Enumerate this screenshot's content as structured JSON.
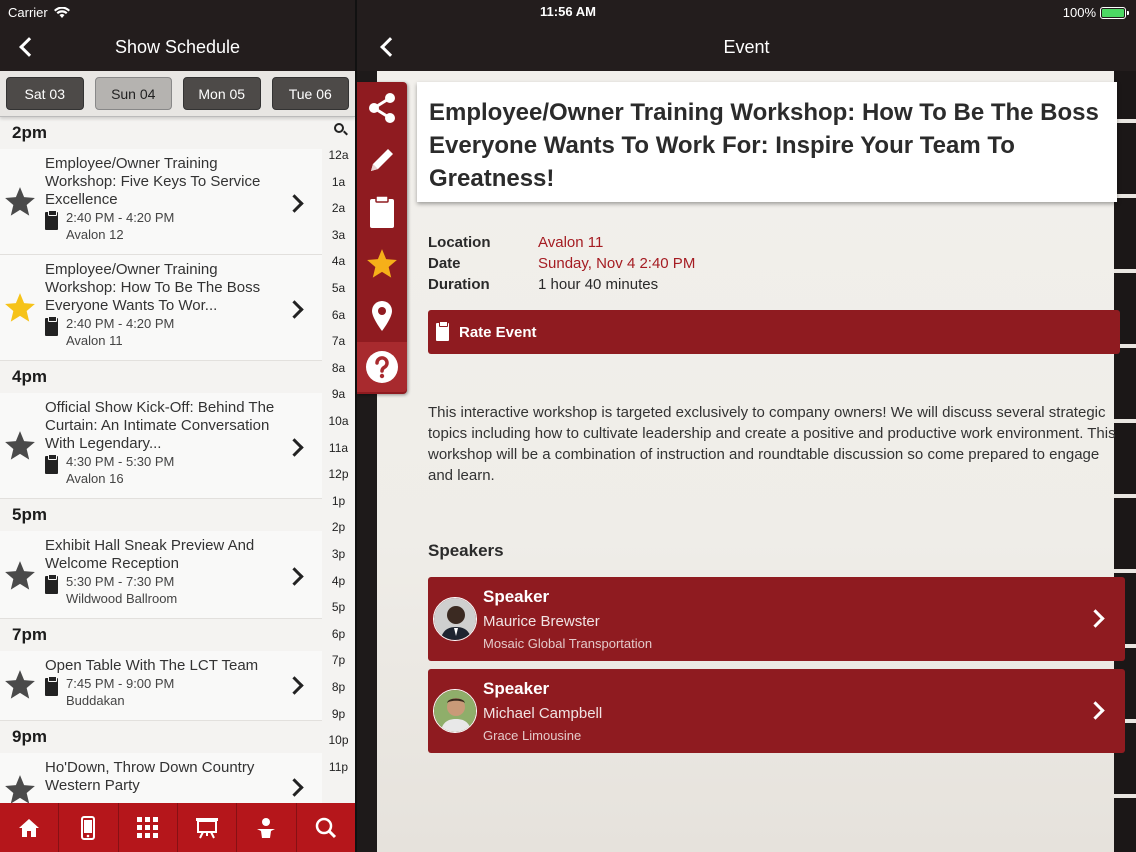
{
  "status": {
    "carrier": "Carrier",
    "time": "11:56 AM",
    "battery": "100%"
  },
  "left": {
    "title": "Show Schedule",
    "days": [
      "Sat 03",
      "Sun 04",
      "Mon 05",
      "Tue 06"
    ],
    "active_day": "Sun 04",
    "groups": [
      {
        "hour": "2pm",
        "events": [
          {
            "title": "Employee/Owner Training Workshop: Five Keys To Service Excellence",
            "time": "2:40 PM - 4:20 PM",
            "location": "Avalon 12",
            "favorite": false
          },
          {
            "title": "Employee/Owner Training Workshop: How To Be The Boss Everyone Wants To Wor...",
            "time": "2:40 PM - 4:20 PM",
            "location": "Avalon 11",
            "favorite": true
          }
        ]
      },
      {
        "hour": "4pm",
        "events": [
          {
            "title": "Official Show Kick-Off: Behind The Curtain: An Intimate Conversation With Legendary...",
            "time": "4:30 PM - 5:30 PM",
            "location": "Avalon 16",
            "favorite": false
          }
        ]
      },
      {
        "hour": "5pm",
        "events": [
          {
            "title": "Exhibit Hall Sneak Preview And Welcome Reception",
            "time": "5:30 PM - 7:30 PM",
            "location": "Wildwood Ballroom",
            "favorite": false
          }
        ]
      },
      {
        "hour": "7pm",
        "events": [
          {
            "title": "Open Table With The LCT Team",
            "time": "7:45 PM - 9:00 PM",
            "location": "Buddakan",
            "favorite": false
          }
        ]
      },
      {
        "hour": "9pm",
        "events": [
          {
            "title": "Ho'Down, Throw Down Country Western Party",
            "time": "",
            "location": "",
            "favorite": false
          }
        ]
      }
    ],
    "index": [
      "12a",
      "1a",
      "2a",
      "3a",
      "4a",
      "5a",
      "6a",
      "7a",
      "8a",
      "9a",
      "10a",
      "11a",
      "12p",
      "1p",
      "2p",
      "3p",
      "4p",
      "5p",
      "6p",
      "7p",
      "8p",
      "9p",
      "10p",
      "11p"
    ],
    "tabs": [
      "home-icon",
      "phone-icon",
      "grid-icon",
      "presentation-icon",
      "person-icon",
      "search-icon"
    ]
  },
  "event": {
    "nav_title": "Event",
    "title": "Employee/Owner Training Workshop: How To Be The Boss Everyone Wants To Work For: Inspire Your Team To Greatness!",
    "location_label": "Location",
    "location": "Avalon 11",
    "date_label": "Date",
    "date": "Sunday, Nov 4 2:40 PM",
    "duration_label": "Duration",
    "duration": "1 hour 40 minutes",
    "rate_label": "Rate Event",
    "description": "This interactive workshop is targeted exclusively to company owners! We will discuss several strategic topics including how to cultivate leadership and create a positive and productive work environment. This workshop will be a combination of instruction and roundtable discussion so come prepared to engage and learn.",
    "speakers_title": "Speakers",
    "speakers": [
      {
        "role": "Speaker",
        "name": "Maurice Brewster",
        "org": "Mosaic Global Transportation"
      },
      {
        "role": "Speaker",
        "name": "Michael Campbell",
        "org": "Grace Limousine"
      }
    ],
    "actions": [
      "share-icon",
      "pencil-icon",
      "clipboard-icon",
      "star-icon",
      "map-pin-icon",
      "help-icon"
    ]
  },
  "colors": {
    "brand_red": "#8f1b20",
    "tabbar_red": "#b5161b",
    "nav_dark": "#231d1d",
    "favorite_star": "#f6c319"
  }
}
